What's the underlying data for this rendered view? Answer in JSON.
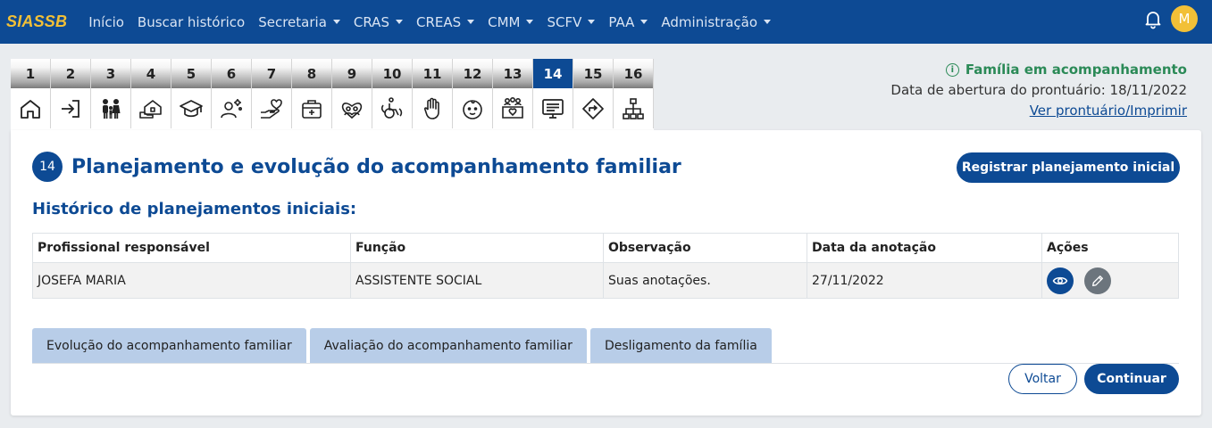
{
  "navbar": {
    "brand": "SIASSB",
    "items": [
      {
        "label": "Início",
        "dropdown": false
      },
      {
        "label": "Buscar histórico",
        "dropdown": false
      },
      {
        "label": "Secretaria",
        "dropdown": true
      },
      {
        "label": "CRAS",
        "dropdown": true
      },
      {
        "label": "CREAS",
        "dropdown": true
      },
      {
        "label": "CMM",
        "dropdown": true
      },
      {
        "label": "SCFV",
        "dropdown": true
      },
      {
        "label": "PAA",
        "dropdown": true
      },
      {
        "label": "Administração",
        "dropdown": true
      }
    ],
    "avatar_initial": "M"
  },
  "steps": {
    "active": "14",
    "items": [
      {
        "num": "1",
        "icon": "home-icon"
      },
      {
        "num": "2",
        "icon": "login-arrow-icon"
      },
      {
        "num": "3",
        "icon": "family-icon"
      },
      {
        "num": "4",
        "icon": "house-hand-icon"
      },
      {
        "num": "5",
        "icon": "graduation-cap-icon"
      },
      {
        "num": "6",
        "icon": "person-gear-icon"
      },
      {
        "num": "7",
        "icon": "hand-heart-icon"
      },
      {
        "num": "8",
        "icon": "medical-kit-icon"
      },
      {
        "num": "9",
        "icon": "group-heart-icon"
      },
      {
        "num": "10",
        "icon": "wheelchair-icon"
      },
      {
        "num": "11",
        "icon": "raised-hand-icon"
      },
      {
        "num": "12",
        "icon": "child-face-icon"
      },
      {
        "num": "13",
        "icon": "community-icon"
      },
      {
        "num": "14",
        "icon": "monitor-list-icon"
      },
      {
        "num": "15",
        "icon": "direction-sign-icon"
      },
      {
        "num": "16",
        "icon": "hierarchy-icon"
      }
    ]
  },
  "info": {
    "status": "Família em acompanhamento",
    "opened_label": "Data de abertura do prontuário: 18/11/2022",
    "print_link": "Ver prontuário/Imprimir"
  },
  "page": {
    "step_badge": "14",
    "title": "Planejamento e evolução do acompanhamento familiar",
    "register_button": "Registrar planejamento inicial",
    "subtitle": "Histórico de planejamentos iniciais:"
  },
  "table": {
    "headers": [
      "Profissional responsável",
      "Função",
      "Observação",
      "Data da anotação",
      "Ações"
    ],
    "rows": [
      [
        "JOSEFA MARIA",
        "ASSISTENTE SOCIAL",
        "Suas anotações.",
        "27/11/2022"
      ]
    ]
  },
  "tabs": [
    "Evolução do acompanhamento familiar",
    "Avaliação do acompanhamento familiar",
    "Desligamento da família"
  ],
  "footer": {
    "back": "Voltar",
    "next": "Continuar"
  },
  "colors": {
    "primary": "#0d4a94",
    "brand": "#f2c037",
    "status": "#2b8a57",
    "tab": "#b8cde8"
  }
}
